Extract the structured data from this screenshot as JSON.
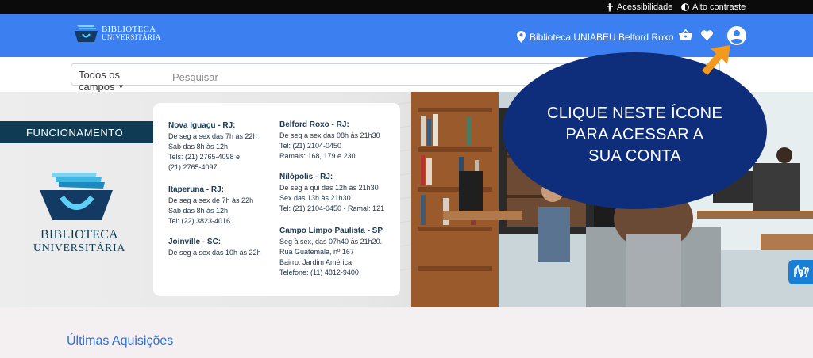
{
  "topbar": {
    "accessibility_label": "Acessibilidade",
    "contrast_label": "Alto contraste"
  },
  "header": {
    "logo_line1": "BIBLIOTECA",
    "logo_line2": "UNIVERSITÁRIA",
    "location_label": "Biblioteca UNIABEU Belford Roxo",
    "icons": [
      "basket-icon",
      "heart-icon",
      "user-account-icon"
    ],
    "brand_color": "#3b7ff0"
  },
  "search": {
    "field_select": "Todos os campos",
    "placeholder": "Pesquisar"
  },
  "banner": {
    "section_label": "FUNCIONAMENTO",
    "logo_line1": "BIBLIOTECA",
    "logo_line2": "UNIVERSITÁRIA",
    "left_column": [
      {
        "title": "Nova Iguaçu - RJ:",
        "lines": [
          "De seg a sex das 7h às 22h",
          "Sab das 8h às 12h",
          "Tels: (21) 2765-4098 e",
          "(21) 2765-4097"
        ]
      },
      {
        "title": "Itaperuna - RJ:",
        "lines": [
          "De seg a sex de 7h às 22h",
          "Sab das 8h às 12h",
          "Tel: (22) 3823-4016"
        ]
      },
      {
        "title": "Joinville - SC:",
        "lines": [
          "De seg a sex das 10h às 22h"
        ]
      }
    ],
    "right_column": [
      {
        "title": "Belford Roxo - RJ:",
        "lines": [
          "De seg a sex das 08h às 21h30",
          "Tel: (21) 2104-0450",
          "Ramais: 168, 179 e 230"
        ]
      },
      {
        "title": "Nilópolis - RJ:",
        "lines": [
          "De seg à qui das 12h às 21h30",
          "Sex das 13h às 21h30",
          "Tel: (21) 2104-0450 - Ramal: 121"
        ]
      },
      {
        "title": "Campo Limpo Paulista - SP",
        "lines": [
          "Seg à sex, das 07h40 às 21h20.",
          "Rua Guatemala, nº 167",
          "Bairro: Jardim América",
          "Telefone: (11) 4812-9400"
        ]
      }
    ]
  },
  "callout": {
    "line1": "CLIQUE NESTE ÍCONE",
    "line2": "PARA ACESSAR A",
    "line3": "SUA CONTA",
    "color": "#0e2d7a",
    "arrow_color": "#f39a1e"
  },
  "lower": {
    "section_title": "Últimas Aquisições"
  }
}
